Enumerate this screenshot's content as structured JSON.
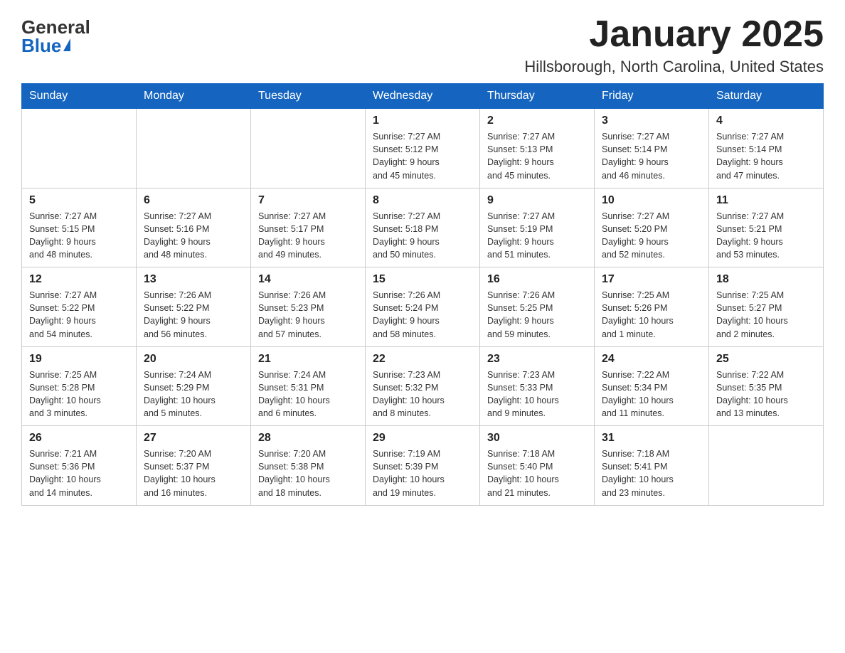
{
  "logo": {
    "general": "General",
    "blue": "Blue"
  },
  "header": {
    "month": "January 2025",
    "location": "Hillsborough, North Carolina, United States"
  },
  "weekdays": [
    "Sunday",
    "Monday",
    "Tuesday",
    "Wednesday",
    "Thursday",
    "Friday",
    "Saturday"
  ],
  "weeks": [
    [
      {
        "day": "",
        "info": ""
      },
      {
        "day": "",
        "info": ""
      },
      {
        "day": "",
        "info": ""
      },
      {
        "day": "1",
        "info": "Sunrise: 7:27 AM\nSunset: 5:12 PM\nDaylight: 9 hours\nand 45 minutes."
      },
      {
        "day": "2",
        "info": "Sunrise: 7:27 AM\nSunset: 5:13 PM\nDaylight: 9 hours\nand 45 minutes."
      },
      {
        "day": "3",
        "info": "Sunrise: 7:27 AM\nSunset: 5:14 PM\nDaylight: 9 hours\nand 46 minutes."
      },
      {
        "day": "4",
        "info": "Sunrise: 7:27 AM\nSunset: 5:14 PM\nDaylight: 9 hours\nand 47 minutes."
      }
    ],
    [
      {
        "day": "5",
        "info": "Sunrise: 7:27 AM\nSunset: 5:15 PM\nDaylight: 9 hours\nand 48 minutes."
      },
      {
        "day": "6",
        "info": "Sunrise: 7:27 AM\nSunset: 5:16 PM\nDaylight: 9 hours\nand 48 minutes."
      },
      {
        "day": "7",
        "info": "Sunrise: 7:27 AM\nSunset: 5:17 PM\nDaylight: 9 hours\nand 49 minutes."
      },
      {
        "day": "8",
        "info": "Sunrise: 7:27 AM\nSunset: 5:18 PM\nDaylight: 9 hours\nand 50 minutes."
      },
      {
        "day": "9",
        "info": "Sunrise: 7:27 AM\nSunset: 5:19 PM\nDaylight: 9 hours\nand 51 minutes."
      },
      {
        "day": "10",
        "info": "Sunrise: 7:27 AM\nSunset: 5:20 PM\nDaylight: 9 hours\nand 52 minutes."
      },
      {
        "day": "11",
        "info": "Sunrise: 7:27 AM\nSunset: 5:21 PM\nDaylight: 9 hours\nand 53 minutes."
      }
    ],
    [
      {
        "day": "12",
        "info": "Sunrise: 7:27 AM\nSunset: 5:22 PM\nDaylight: 9 hours\nand 54 minutes."
      },
      {
        "day": "13",
        "info": "Sunrise: 7:26 AM\nSunset: 5:22 PM\nDaylight: 9 hours\nand 56 minutes."
      },
      {
        "day": "14",
        "info": "Sunrise: 7:26 AM\nSunset: 5:23 PM\nDaylight: 9 hours\nand 57 minutes."
      },
      {
        "day": "15",
        "info": "Sunrise: 7:26 AM\nSunset: 5:24 PM\nDaylight: 9 hours\nand 58 minutes."
      },
      {
        "day": "16",
        "info": "Sunrise: 7:26 AM\nSunset: 5:25 PM\nDaylight: 9 hours\nand 59 minutes."
      },
      {
        "day": "17",
        "info": "Sunrise: 7:25 AM\nSunset: 5:26 PM\nDaylight: 10 hours\nand 1 minute."
      },
      {
        "day": "18",
        "info": "Sunrise: 7:25 AM\nSunset: 5:27 PM\nDaylight: 10 hours\nand 2 minutes."
      }
    ],
    [
      {
        "day": "19",
        "info": "Sunrise: 7:25 AM\nSunset: 5:28 PM\nDaylight: 10 hours\nand 3 minutes."
      },
      {
        "day": "20",
        "info": "Sunrise: 7:24 AM\nSunset: 5:29 PM\nDaylight: 10 hours\nand 5 minutes."
      },
      {
        "day": "21",
        "info": "Sunrise: 7:24 AM\nSunset: 5:31 PM\nDaylight: 10 hours\nand 6 minutes."
      },
      {
        "day": "22",
        "info": "Sunrise: 7:23 AM\nSunset: 5:32 PM\nDaylight: 10 hours\nand 8 minutes."
      },
      {
        "day": "23",
        "info": "Sunrise: 7:23 AM\nSunset: 5:33 PM\nDaylight: 10 hours\nand 9 minutes."
      },
      {
        "day": "24",
        "info": "Sunrise: 7:22 AM\nSunset: 5:34 PM\nDaylight: 10 hours\nand 11 minutes."
      },
      {
        "day": "25",
        "info": "Sunrise: 7:22 AM\nSunset: 5:35 PM\nDaylight: 10 hours\nand 13 minutes."
      }
    ],
    [
      {
        "day": "26",
        "info": "Sunrise: 7:21 AM\nSunset: 5:36 PM\nDaylight: 10 hours\nand 14 minutes."
      },
      {
        "day": "27",
        "info": "Sunrise: 7:20 AM\nSunset: 5:37 PM\nDaylight: 10 hours\nand 16 minutes."
      },
      {
        "day": "28",
        "info": "Sunrise: 7:20 AM\nSunset: 5:38 PM\nDaylight: 10 hours\nand 18 minutes."
      },
      {
        "day": "29",
        "info": "Sunrise: 7:19 AM\nSunset: 5:39 PM\nDaylight: 10 hours\nand 19 minutes."
      },
      {
        "day": "30",
        "info": "Sunrise: 7:18 AM\nSunset: 5:40 PM\nDaylight: 10 hours\nand 21 minutes."
      },
      {
        "day": "31",
        "info": "Sunrise: 7:18 AM\nSunset: 5:41 PM\nDaylight: 10 hours\nand 23 minutes."
      },
      {
        "day": "",
        "info": ""
      }
    ]
  ]
}
